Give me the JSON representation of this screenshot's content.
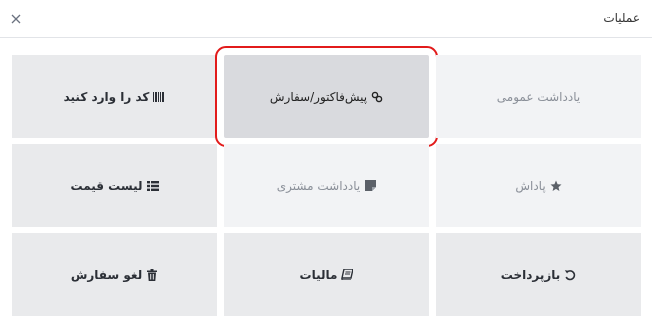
{
  "dialog": {
    "title": "عملیات",
    "close_icon": "close-icon"
  },
  "tiles": [
    {
      "label": "یادداشت عمومی",
      "icon": "none"
    },
    {
      "label": "پیش‌فاکتور/سفارش",
      "icon": "link-icon"
    },
    {
      "label": "کد را وارد کنید",
      "icon": "barcode-icon"
    },
    {
      "label": "پاداش",
      "icon": "star-icon"
    },
    {
      "label": "یادداشت مشتری",
      "icon": "sticky-note-icon"
    },
    {
      "label": "لیست قیمت",
      "icon": "list-icon"
    },
    {
      "label": "بازپرداخت",
      "icon": "undo-icon"
    },
    {
      "label": "مالیات",
      "icon": "book-icon"
    },
    {
      "label": "لغو سفارش",
      "icon": "trash-icon"
    }
  ],
  "colors": {
    "highlight": "#e21b1b",
    "tile_bg": "#e9eaec",
    "tile_muted_bg": "#f2f3f5"
  }
}
